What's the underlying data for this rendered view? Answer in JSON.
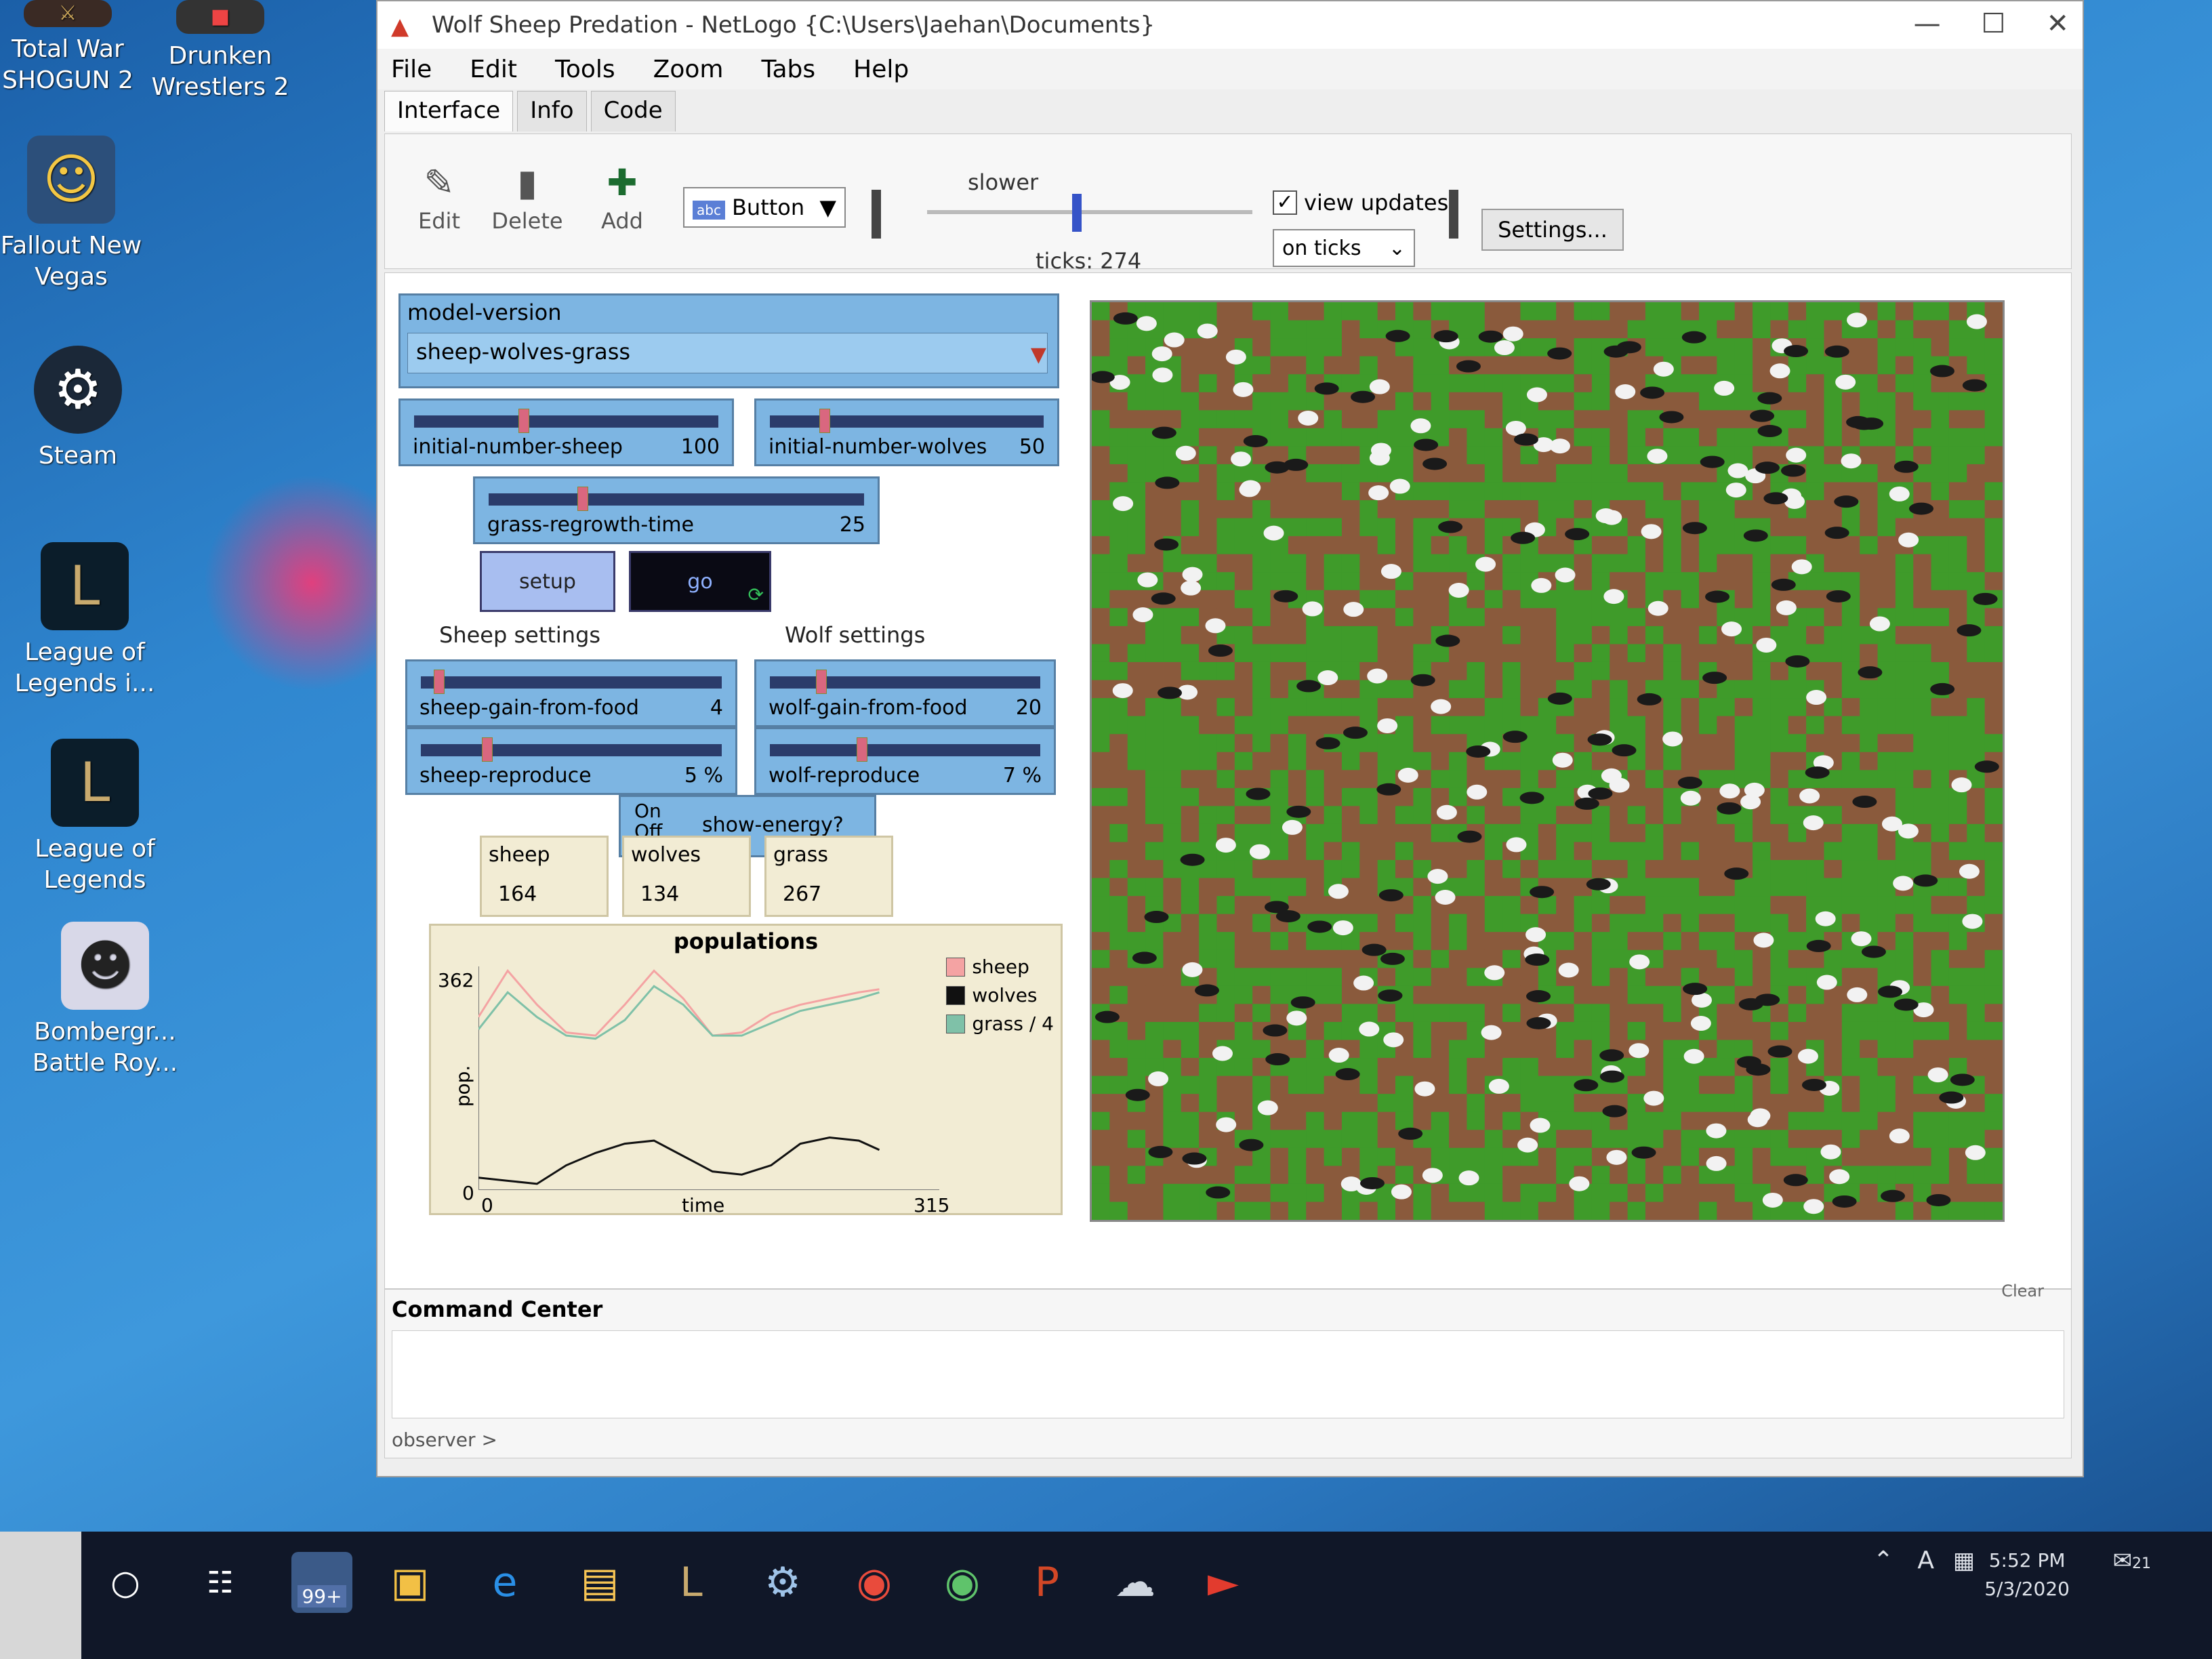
{
  "desktop": {
    "icons": [
      {
        "label_1": "Total War",
        "label_2": "SHOGUN 2",
        "icon": "shogun-icon"
      },
      {
        "label_1": "Drunken",
        "label_2": "Wrestlers 2",
        "icon": "wrestlers-icon"
      },
      {
        "label_1": "Fallout New",
        "label_2": "Vegas",
        "icon": "fallout-icon"
      },
      {
        "label_1": "Steam",
        "label_2": "",
        "icon": "steam-icon"
      },
      {
        "label_1": "League of",
        "label_2": "Legends i...",
        "icon": "league-icon"
      },
      {
        "label_1": "League of",
        "label_2": "Legends",
        "icon": "league-icon"
      },
      {
        "label_1": "Bombergr...",
        "label_2": "Battle Roy...",
        "icon": "bomber-icon"
      }
    ]
  },
  "window": {
    "title": "Wolf Sheep Predation - NetLogo {C:\\Users\\Jaehan\\Documents}",
    "menu": [
      "File",
      "Edit",
      "Tools",
      "Zoom",
      "Tabs",
      "Help"
    ],
    "tabs": [
      "Interface",
      "Info",
      "Code"
    ],
    "active_tab": "Interface"
  },
  "toolbar": {
    "edit_label": "Edit",
    "delete_label": "Delete",
    "add_label": "Add",
    "widget_type": "Button",
    "speed_label": "slower",
    "speed_level": 0.46,
    "ticks_text": "ticks: 274",
    "view_updates_label": "view updates",
    "view_updates_checked": true,
    "update_mode": "on ticks",
    "settings_label": "Settings..."
  },
  "interface": {
    "chooser": {
      "label": "model-version",
      "value": "sheep-wolves-grass"
    },
    "sliders": {
      "initial_number_sheep": {
        "name": "initial-number-sheep",
        "value": "100",
        "level": 0.36
      },
      "initial_number_wolves": {
        "name": "initial-number-wolves",
        "value": "50",
        "level": 0.2
      },
      "grass_regrowth_time": {
        "name": "grass-regrowth-time",
        "value": "25",
        "level": 0.25
      },
      "sheep_gain_from_food": {
        "name": "sheep-gain-from-food",
        "value": "4",
        "level": 0.06
      },
      "wolf_gain_from_food": {
        "name": "wolf-gain-from-food",
        "value": "20",
        "level": 0.19
      },
      "sheep_reproduce": {
        "name": "sheep-reproduce",
        "value": "5 %",
        "level": 0.22
      },
      "wolf_reproduce": {
        "name": "wolf-reproduce",
        "value": "7 %",
        "level": 0.34
      }
    },
    "setup_label": "setup",
    "go_label": "go",
    "sheep_settings_label": "Sheep settings",
    "wolf_settings_label": "Wolf settings",
    "switch": {
      "on": "On",
      "off": "Off",
      "name": "show-energy?"
    },
    "monitors": [
      {
        "label": "sheep",
        "value": "164"
      },
      {
        "label": "wolves",
        "value": "134"
      },
      {
        "label": "grass",
        "value": "267"
      }
    ],
    "plot": {
      "title": "populations",
      "ylabel": "pop.",
      "xlabel": "time",
      "ymax_label": "362",
      "ymin_label": "0",
      "xmin_label": "0",
      "xmax_label": "315"
    },
    "command_center": {
      "title": "Command Center",
      "clear_label": "Clear",
      "prompt": "observer >"
    }
  },
  "chart_data": {
    "type": "line",
    "title": "populations",
    "xlabel": "time",
    "ylabel": "pop.",
    "xlim": [
      0,
      315
    ],
    "ylim": [
      0,
      362
    ],
    "x": [
      0,
      20,
      40,
      60,
      80,
      100,
      120,
      140,
      160,
      180,
      200,
      220,
      240,
      260,
      274
    ],
    "series": [
      {
        "name": "sheep",
        "color": "#f4a3a3",
        "values": [
          280,
          355,
          300,
          255,
          250,
          300,
          355,
          310,
          250,
          255,
          285,
          300,
          310,
          320,
          325
        ]
      },
      {
        "name": "wolves",
        "color": "#111111",
        "values": [
          20,
          15,
          10,
          40,
          60,
          75,
          80,
          55,
          30,
          25,
          40,
          75,
          85,
          80,
          65
        ]
      },
      {
        "name": "grass / 4",
        "color": "#7fc1a8",
        "values": [
          260,
          320,
          280,
          250,
          245,
          275,
          330,
          300,
          250,
          250,
          270,
          290,
          300,
          310,
          320
        ]
      }
    ]
  },
  "colors": {
    "widget_blue": "#7db5e2",
    "grass_green": "#3f9b2a",
    "dirt_brown": "#8a5a3c",
    "sheep_white": "#f2f2f2",
    "wolf_black": "#1a1a1a"
  },
  "taskbar": {
    "mail_badge": "99+",
    "time": "5:52 PM",
    "date": "5/3/2020",
    "notification_count": "21",
    "tray_lang": "A"
  }
}
